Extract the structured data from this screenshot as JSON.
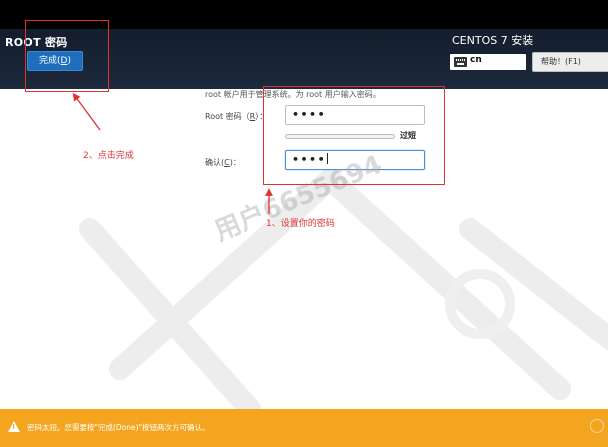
{
  "header": {
    "title": "ROOT 密码",
    "done_label": "完成(",
    "done_key": "D",
    "done_close": ")",
    "install_title": "CENTOS 7 安装",
    "keyboard": "cn",
    "help_label": "帮助！(F1)"
  },
  "form": {
    "description": "root 帐户用于管理系统。为 root 用户输入密码。",
    "root_label_prefix": "Root 密码（",
    "root_label_key": "R",
    "root_label_suffix": "）：",
    "root_password": "••••",
    "strength_text": "过短",
    "strength_fill_fraction": 0.0,
    "confirm_label_prefix": "确认(",
    "confirm_label_key": "C",
    "confirm_label_suffix": ")：",
    "confirm_password": "••••"
  },
  "annotations": {
    "step1": "1、设置你的密码",
    "step2": "2、点击完成",
    "color": "#e03333"
  },
  "watermark": "用户6655694",
  "status": {
    "message": "密码太短。您需要按\"完成(Done)\"按钮两次方可确认。",
    "color": "#f3a51f"
  },
  "colors": {
    "header_bg": "#1d2a3c",
    "done_button": "#1f6ebe",
    "focus_border": "#4a90d9"
  },
  "icons": [
    "keyboard-icon",
    "warning-icon"
  ]
}
